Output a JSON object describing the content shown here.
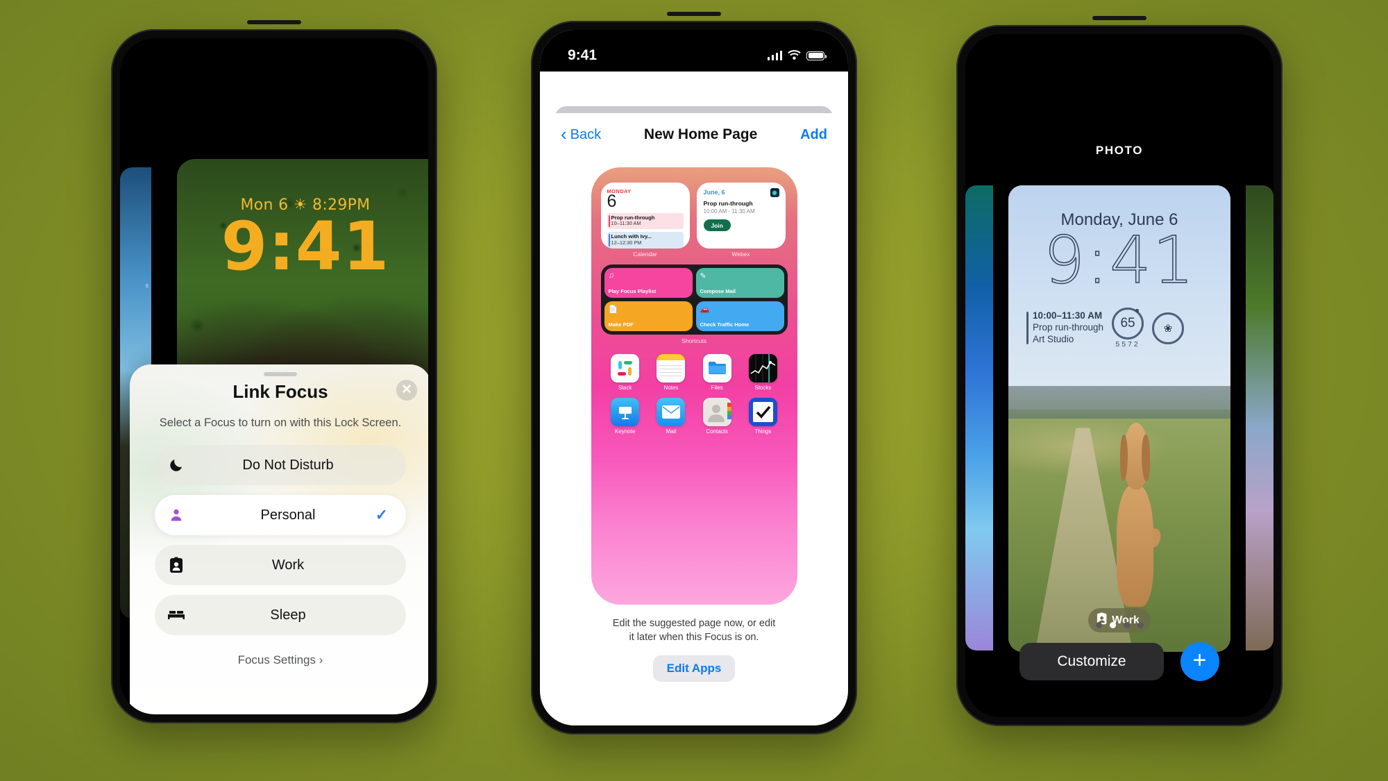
{
  "phone1": {
    "lock_screen": {
      "date": "Mon 6",
      "temp": "8:29PM",
      "weather_icon": "sun-icon",
      "time": "9:41"
    },
    "sheet": {
      "title": "Link Focus",
      "close_icon": "close-icon",
      "subtitle": "Select a Focus to turn on with this Lock Screen.",
      "options": [
        {
          "label": "Do Not Disturb",
          "icon": "moon-icon",
          "selected": false
        },
        {
          "label": "Personal",
          "icon": "person-icon",
          "selected": true
        },
        {
          "label": "Work",
          "icon": "badge-icon",
          "selected": false
        },
        {
          "label": "Sleep",
          "icon": "bed-icon",
          "selected": false
        }
      ],
      "check_icon": "checkmark-icon",
      "settings_link": "Focus Settings",
      "settings_chevron": "chevron-right-icon"
    }
  },
  "phone2": {
    "status_bar": {
      "time": "9:41",
      "signal_icon": "cellular-bars-icon",
      "wifi_icon": "wifi-icon",
      "battery_icon": "battery-icon"
    },
    "nav": {
      "back_label": "Back",
      "back_icon": "chevron-left-icon",
      "title": "New Home Page",
      "add_label": "Add"
    },
    "widgets": {
      "calendar": {
        "caption": "Calendar",
        "day_of_week": "MONDAY",
        "day_number": "6",
        "events": [
          {
            "title": "Prop run-through",
            "time": "10–11:30 AM",
            "color": "#e9415f"
          },
          {
            "title": "Lunch with Ivy...",
            "time": "12–12:30 PM",
            "color": "#3b7fd4"
          }
        ]
      },
      "webex": {
        "caption": "Webex",
        "date": "June, 6",
        "title": "Prop run-through",
        "time": "10:00 AM - 11:30 AM",
        "button": "Join",
        "app_icon": "webex-icon"
      },
      "shortcuts": {
        "caption": "Shortcuts",
        "tiles": [
          {
            "label": "Play Focus Playlist",
            "icon": "music-note-icon",
            "color": "#f5459f"
          },
          {
            "label": "Compose Mail",
            "icon": "compose-icon",
            "color": "#4fb8a5"
          },
          {
            "label": "Make PDF",
            "icon": "document-icon",
            "color": "#f5a623"
          },
          {
            "label": "Check Traffic Home",
            "icon": "car-icon",
            "color": "#43a9f0"
          }
        ]
      }
    },
    "apps": [
      {
        "name": "Slack",
        "icon": "slack-icon"
      },
      {
        "name": "Notes",
        "icon": "notes-icon"
      },
      {
        "name": "Files",
        "icon": "files-icon"
      },
      {
        "name": "Stocks",
        "icon": "stocks-icon"
      },
      {
        "name": "Keynote",
        "icon": "keynote-icon"
      },
      {
        "name": "Mail",
        "icon": "mail-icon"
      },
      {
        "name": "Contacts",
        "icon": "contacts-icon"
      },
      {
        "name": "Things",
        "icon": "things-icon"
      }
    ],
    "footer": {
      "line1": "Edit the suggested page now, or edit",
      "line2": "it later when this Focus is on.",
      "button": "Edit Apps"
    }
  },
  "phone3": {
    "label": "PHOTO",
    "lock_screen": {
      "date": "Monday, June 6",
      "time": "9:41",
      "calendar_widget": {
        "time": "10:00–11:30 AM",
        "title": "Prop run-through",
        "location": "Art Studio"
      },
      "temp_widget": {
        "value": "65",
        "low": "55",
        "high": "72"
      },
      "air_widget": {
        "icon": "pollen-icon"
      },
      "focus_badge": {
        "label": "Work",
        "icon": "badge-icon"
      }
    },
    "page_dots": {
      "count": 4,
      "active_index": 1
    },
    "customize_button": "Customize",
    "add_button_icon": "plus-icon"
  },
  "colors": {
    "accent_blue": "#0a7bf5",
    "add_blue": "#0a84ff",
    "lock_yellow": "#f4ad21",
    "purple": "#a54fd6",
    "background_olive": "#7e8c26"
  }
}
